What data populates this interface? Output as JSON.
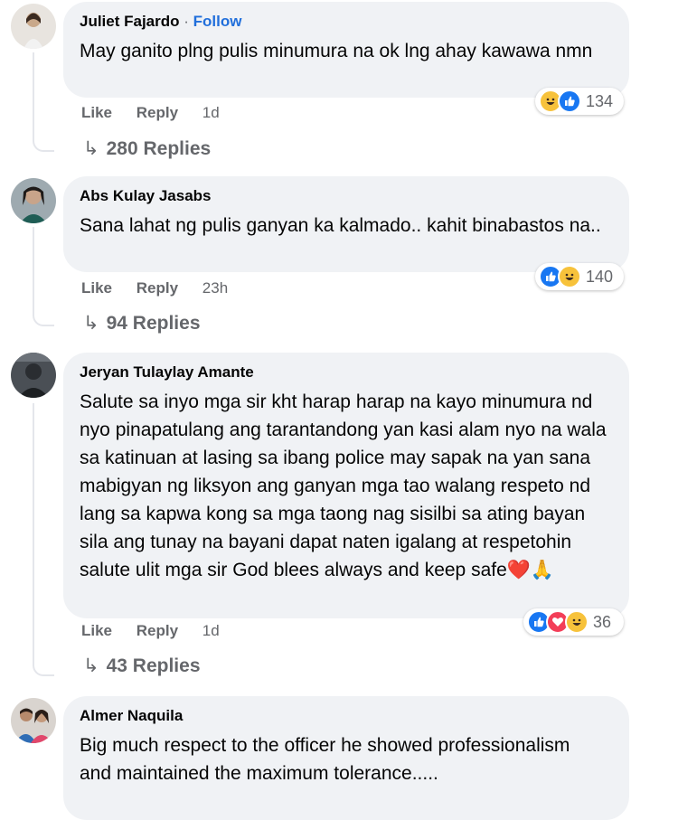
{
  "comments": [
    {
      "author": "Juliet Fajardo",
      "follow_label": "Follow",
      "text": "May ganito plng pulis minumura na ok lng ahay kawawa nmn",
      "like_label": "Like",
      "reply_label": "Reply",
      "time": "1d",
      "reaction_count": "134",
      "reactions": [
        "haha",
        "like"
      ],
      "replies_label": "280 Replies"
    },
    {
      "author": "Abs Kulay Jasabs",
      "text": "Sana lahat ng pulis ganyan ka kalmado.. kahit binabastos na..",
      "like_label": "Like",
      "reply_label": "Reply",
      "time": "23h",
      "reaction_count": "140",
      "reactions": [
        "like",
        "haha"
      ],
      "replies_label": "94 Replies"
    },
    {
      "author": "Jeryan Tulaylay Amante",
      "text": "Salute sa inyo mga sir kht harap harap na kayo minumura nd nyo pinapatulang ang tarantandong yan kasi alam nyo na wala sa katinuan at lasing sa ibang police may sapak na yan sana mabigyan ng liksyon ang ganyan mga tao walang respeto nd lang sa kapwa kong sa mga taong nag sisilbi sa ating bayan sila ang tunay na bayani dapat naten igalang at respetohin salute ulit mga sir God blees always and keep safe❤️🙏",
      "like_label": "Like",
      "reply_label": "Reply",
      "time": "1d",
      "reaction_count": "36",
      "reactions": [
        "like",
        "love",
        "haha"
      ],
      "replies_label": "43 Replies"
    },
    {
      "author": "Almer Naquila",
      "text": "Big much respect to the officer he showed professionalism and maintained the maximum tolerance....."
    }
  ],
  "colors": {
    "bubble": "#f0f2f5",
    "link": "#216fdb",
    "muted": "#65676b",
    "like": "#1877f2",
    "haha": "#f7c23b",
    "love": "#f33e58"
  }
}
